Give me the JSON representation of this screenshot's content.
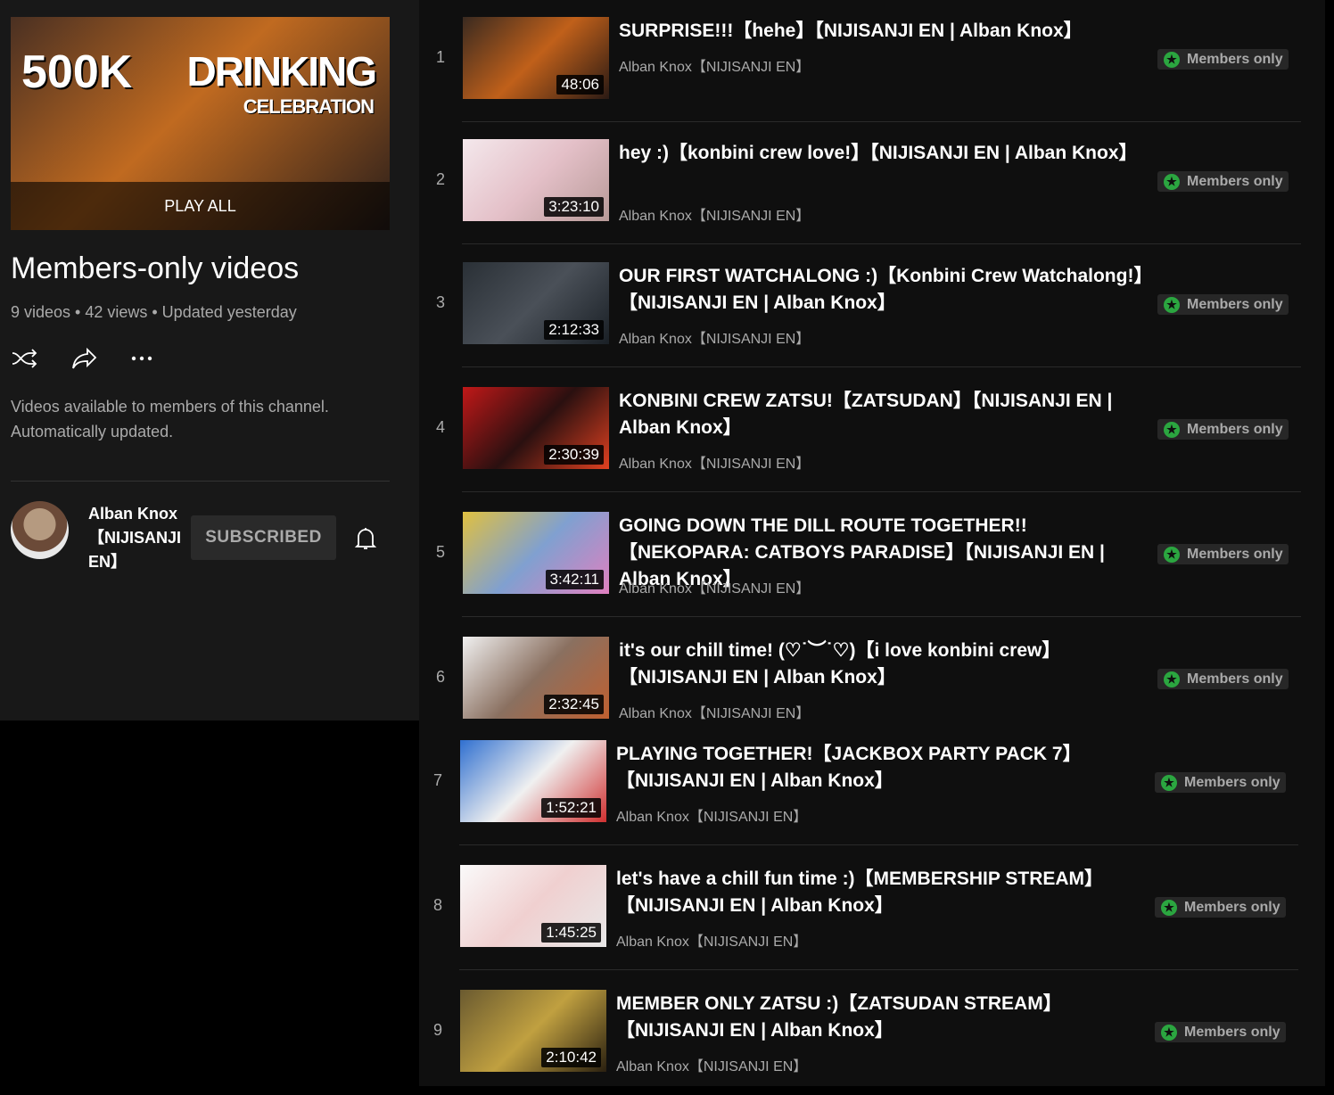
{
  "playlist": {
    "thumb_text": [
      "500K",
      "DRINKING",
      "CELEBRATION"
    ],
    "play_all": "PLAY ALL",
    "title": "Members-only videos",
    "meta": "9 videos • 42 views • Updated yesterday",
    "description": "Videos available to members of this channel. Automatically updated.",
    "channel": "Alban Knox【NIJISANJI EN】",
    "subscribe_label": "SUBSCRIBED"
  },
  "badge_color": "#2ba640",
  "videos": [
    {
      "n": "1",
      "title": "SURPRISE!!!【hehe】【NIJISANJI EN | Alban Knox】",
      "channel": "Alban Knox【NIJISANJI EN】",
      "duration": "48:06",
      "badge": "Members only",
      "bg": "linear-gradient(135deg,#3a2a20,#c0601a,#2a1a14)"
    },
    {
      "n": "2",
      "title": "hey :)【konbini crew love!】【NIJISANJI EN | Alban Knox】",
      "channel": "Alban Knox【NIJISANJI EN】",
      "duration": "3:23:10",
      "badge": "Members only",
      "bg": "linear-gradient(135deg,#f4e8ec,#e4c0c8,#b89a98)"
    },
    {
      "n": "3",
      "title": "OUR FIRST WATCHALONG :)【Konbini Crew Watchalong!】【NIJISANJI EN | Alban Knox】",
      "channel": "Alban Knox【NIJISANJI EN】",
      "duration": "2:12:33",
      "badge": "Members only",
      "bg": "linear-gradient(135deg,#2a3036,#4a5058,#1a2026)"
    },
    {
      "n": "4",
      "title": "KONBINI CREW ZATSU!【ZATSUDAN】【NIJISANJI EN | Alban Knox】",
      "channel": "Alban Knox【NIJISANJI EN】",
      "duration": "2:30:39",
      "badge": "Members only",
      "bg": "linear-gradient(135deg,#c01818,#2a1010,#e04020)"
    },
    {
      "n": "5",
      "title": "GOING DOWN THE DILL ROUTE TOGETHER!!【NEKOPARA: CATBOYS PARADISE】【NIJISANJI EN | Alban Knox】",
      "channel": "Alban Knox【NIJISANJI EN】",
      "duration": "3:42:11",
      "badge": "Members only",
      "bg": "linear-gradient(135deg,#e0c040,#80a0d0,#e080c0)"
    },
    {
      "n": "6",
      "title": "it's our chill time! (♡˙︶˙♡)【i love konbini crew】【NIJISANJI EN | Alban Knox】",
      "channel": "Alban Knox【NIJISANJI EN】",
      "duration": "2:32:45",
      "badge": "Members only",
      "bg": "linear-gradient(135deg,#f0f0f0,#8a7060,#c06030)"
    },
    {
      "n": "7",
      "title": "PLAYING TOGETHER!【JACKBOX PARTY PACK 7】【NIJISANJI EN | Alban Knox】",
      "channel": "Alban Knox【NIJISANJI EN】",
      "duration": "1:52:21",
      "badge": "Members only",
      "bg": "linear-gradient(135deg,#3070d0,#f0f0f0,#d03030)"
    },
    {
      "n": "8",
      "title": "let's have a chill fun time :)【MEMBERSHIP STREAM】【NIJISANJI EN | Alban Knox】",
      "channel": "Alban Knox【NIJISANJI EN】",
      "duration": "1:45:25",
      "badge": "Members only",
      "bg": "linear-gradient(135deg,#fafafa,#f0d0d0,#e8e8e8)"
    },
    {
      "n": "9",
      "title": "MEMBER ONLY ZATSU :)【ZATSUDAN STREAM】【NIJISANJI EN | Alban Knox】",
      "channel": "Alban Knox【NIJISANJI EN】",
      "duration": "2:10:42",
      "badge": "Members only",
      "bg": "linear-gradient(135deg,#6a5a30,#c0a040,#2a2010)"
    }
  ]
}
